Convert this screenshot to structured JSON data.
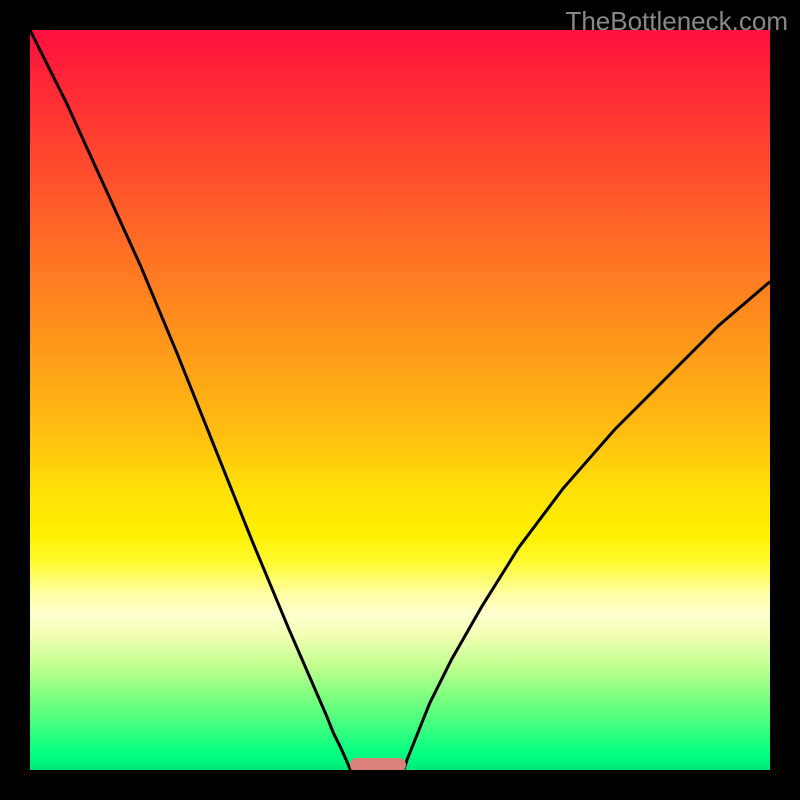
{
  "watermark": "TheBottleneck.com",
  "chart_data": {
    "type": "line",
    "title": "",
    "xlabel": "",
    "ylabel": "",
    "xlim": [
      0,
      100
    ],
    "ylim": [
      0,
      100
    ],
    "gradient_stops": [
      {
        "pct": 0,
        "color": "#ff1040"
      },
      {
        "pct": 15,
        "color": "#ff4030"
      },
      {
        "pct": 35,
        "color": "#ff8020"
      },
      {
        "pct": 55,
        "color": "#ffc010"
      },
      {
        "pct": 68,
        "color": "#fff000"
      },
      {
        "pct": 79,
        "color": "#ffffd0"
      },
      {
        "pct": 90,
        "color": "#80ff80"
      },
      {
        "pct": 100,
        "color": "#00e878"
      }
    ],
    "series": [
      {
        "name": "left-curve",
        "x": [
          0,
          5,
          10,
          15,
          20,
          25,
          30,
          35,
          40,
          41,
          42,
          42.8,
          43.3
        ],
        "y": [
          100,
          90,
          79,
          68,
          56,
          43.5,
          31,
          19,
          7.5,
          5,
          3,
          1.2,
          0
        ]
      },
      {
        "name": "right-curve",
        "x": [
          50.5,
          51,
          52,
          54,
          57,
          61,
          66,
          72,
          79,
          86,
          93,
          100
        ],
        "y": [
          0,
          1.5,
          4,
          9,
          15,
          22,
          30,
          38,
          46,
          53,
          60,
          66
        ]
      }
    ],
    "marker": {
      "x_center": 47,
      "y": 0.5,
      "width_pct": 7.5
    }
  }
}
